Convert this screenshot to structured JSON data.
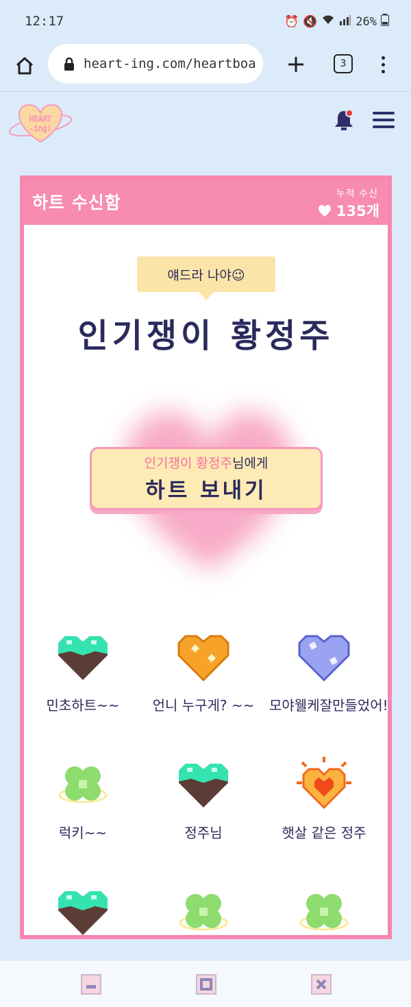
{
  "status_bar": {
    "time": "12:17",
    "battery": "26%"
  },
  "browser": {
    "url": "heart-ing.com/heartboa",
    "tab_count": "3"
  },
  "app": {
    "logo_text": "HEART -ing!"
  },
  "inbox": {
    "title": "하트 수신함",
    "total_label": "누적 수신",
    "total_count": "135개",
    "tooltip": "얘드라 나야😉",
    "owner_name": "인기쟁이 황정주",
    "send_button": {
      "recipient": "인기쟁이 황정주",
      "suffix": "님에게",
      "label": "하트 보내기"
    },
    "hearts": [
      {
        "label": "민초하트~~",
        "icon": "mint-choco-heart-icon"
      },
      {
        "label": "언니 누구게? ~~",
        "icon": "orange-heart-icon"
      },
      {
        "label": "모야웰케잘만들었어!!!",
        "icon": "blue-heart-icon"
      },
      {
        "label": "럭키~~",
        "icon": "clover-icon"
      },
      {
        "label": "정주님",
        "icon": "mint-choco-heart-icon"
      },
      {
        "label": "햇살 같은 정주",
        "icon": "sunshine-heart-icon"
      },
      {
        "label": "",
        "icon": "mint-choco-heart-icon"
      },
      {
        "label": "",
        "icon": "clover-icon"
      },
      {
        "label": "",
        "icon": "clover-icon"
      }
    ]
  },
  "colors": {
    "background": "#dcebf9",
    "pink": "#f78bb1",
    "navy": "#2b2a5c",
    "cream": "#fdeab5"
  }
}
